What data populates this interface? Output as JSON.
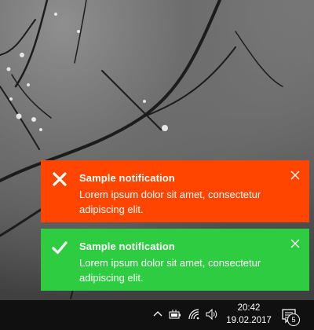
{
  "notifications": [
    {
      "type": "error",
      "icon": "x-mark-icon",
      "color": "#ff4500",
      "title": "Sample notification",
      "message": "Lorem ipsum dolor sit amet, consectetur adipiscing elit."
    },
    {
      "type": "success",
      "icon": "checkmark-icon",
      "color": "#2ecc40",
      "title": "Sample notification",
      "message": "Lorem ipsum dolor sit amet, consectetur adipiscing elit."
    }
  ],
  "taskbar": {
    "time": "20:42",
    "date": "19.02.2017",
    "notification_count": "5",
    "tray_icons": [
      "chevron-up-icon",
      "battery-icon",
      "wifi-icon",
      "volume-icon"
    ],
    "background": "#101010"
  }
}
